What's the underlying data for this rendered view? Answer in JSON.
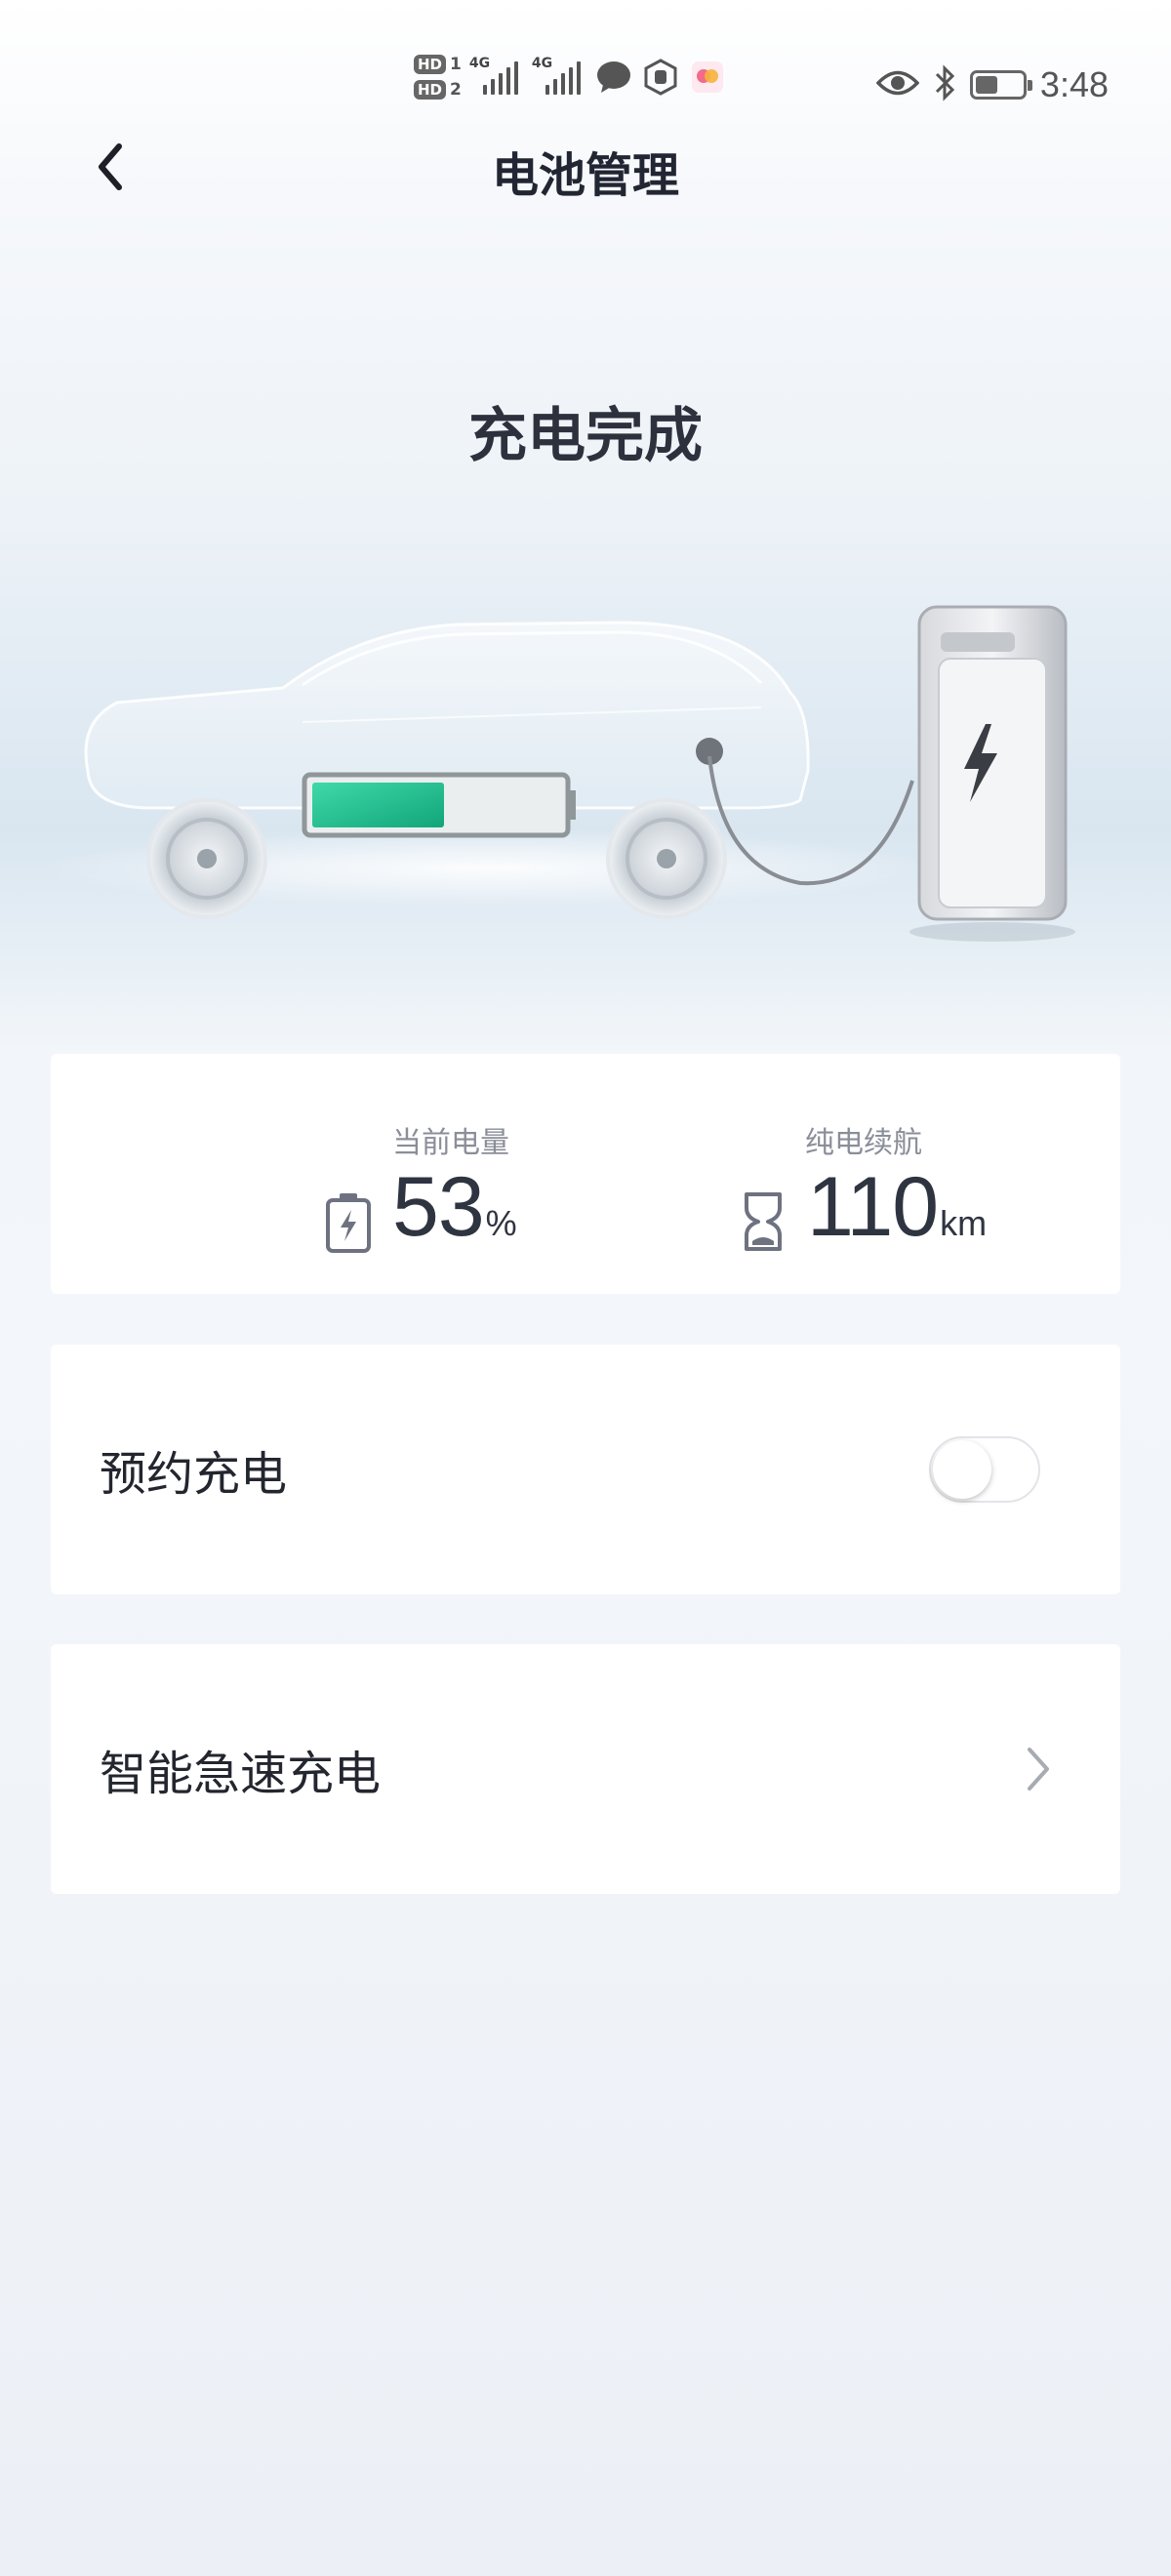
{
  "status_bar": {
    "sim1_label": "HD",
    "sim1_index": "1",
    "sim2_label": "HD",
    "sim2_index": "2",
    "signal1_label": "4G",
    "signal2_label": "4G",
    "time": "3:48",
    "icons": [
      "wechat-icon",
      "hand-icon",
      "app-notification-icon",
      "eye-icon",
      "bluetooth-icon",
      "battery-icon"
    ]
  },
  "header": {
    "title": "电池管理",
    "back_icon": "chevron-left-icon"
  },
  "hero": {
    "status": "充电完成",
    "battery_fill_level": 0.53,
    "colors": {
      "battery_fill": "#1fbf8f",
      "charger_bolt": "#3a3d44"
    }
  },
  "stats": {
    "battery": {
      "label": "当前电量",
      "value": "53",
      "unit": "%",
      "icon": "battery-charging-icon"
    },
    "range": {
      "label": "纯电续航",
      "value": "110",
      "unit": "km",
      "icon": "hourglass-icon"
    }
  },
  "settings": {
    "scheduled_charging": {
      "label": "预约充电",
      "enabled": false
    },
    "smart_fast_charging": {
      "label": "智能急速充电",
      "icon": "chevron-right-icon"
    }
  }
}
